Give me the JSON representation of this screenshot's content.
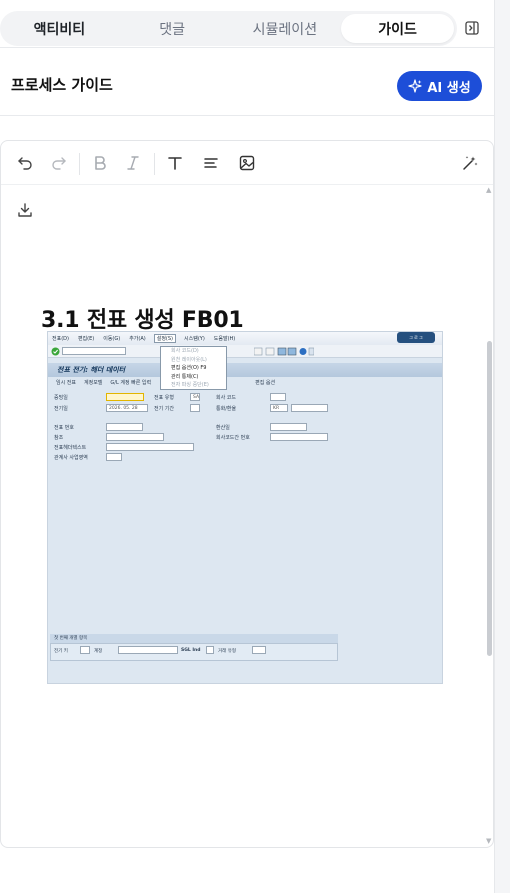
{
  "tabs": [
    {
      "label": "액티비티"
    },
    {
      "label": "댓글"
    },
    {
      "label": "시뮬레이션"
    },
    {
      "label": "가이드"
    }
  ],
  "header": {
    "title": "프로세스 가이드",
    "ai_button_label": "AI 생성"
  },
  "toolbar": {
    "icons": [
      "undo-icon",
      "redo-icon",
      "bold-icon",
      "italic-icon",
      "text-style-icon",
      "align-icon",
      "image-icon",
      "magic-wand-icon"
    ]
  },
  "document": {
    "heading_prefix": "3.1 전표 생성 ",
    "heading_code": "FB01"
  },
  "sap": {
    "menus": [
      "전표(D)",
      "편집(E)",
      "이동(G)",
      "추가(A)",
      "설정(S)",
      "시스템(Y)",
      "도움말(H)"
    ],
    "dropdown": [
      {
        "label": "회사 코드(D)",
        "disabled": true
      },
      {
        "label": "원천 레이아웃(L)",
        "disabled": true
      },
      {
        "label": "편집 옵션(O)   F9",
        "disabled": false
      },
      {
        "label": "관리 통제(C)",
        "disabled": false
      },
      {
        "label": "전자 파싱 중단(E)",
        "disabled": true
      }
    ],
    "title": "전표 전기: 헤더 데이터",
    "app_toolbar": [
      "임시 전표",
      "계정모델",
      "G/L 계정 빠른 입력",
      "편집 옵션"
    ],
    "fields": {
      "doc_date": "증빙일",
      "doc_type": "전표 유형",
      "doc_type_value": "SA",
      "company_code": "회사 코드",
      "posting_date": "전기일",
      "posting_date_value": "2026. 05. 28",
      "period": "전기 기간",
      "currency": "통화/환율",
      "currency_value": "KR",
      "doc_number": "전표 번호",
      "exchange_rate": "환산일",
      "reference": "참조",
      "intercompany": "회사코드간 번호",
      "header_text": "전표헤더텍스트",
      "partner": "관계사 사업영역"
    },
    "bottom": {
      "section": "첫 번째 개별 항목",
      "posting_key": "전기 키",
      "account": "계정",
      "sgl": "SGL Ind",
      "trans_type": "거래 유형"
    },
    "top_button": "그 로 그"
  },
  "colors": {
    "accent": "#1d4ed8",
    "spellcheck": "#e53935"
  }
}
